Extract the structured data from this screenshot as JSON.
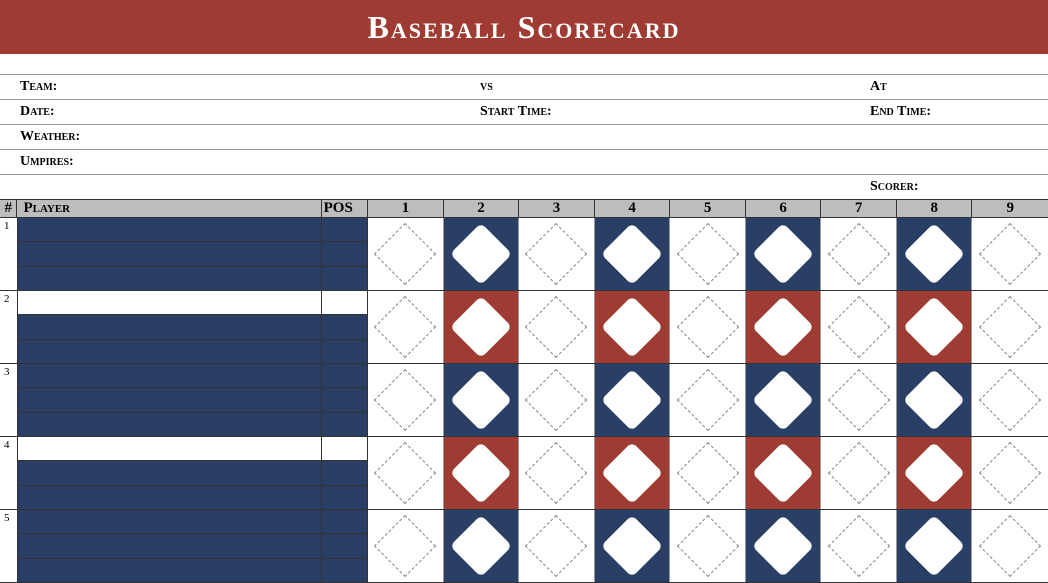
{
  "title": "Baseball Scorecard",
  "info": {
    "team_label": "Team:",
    "vs_label": "vs",
    "at_label": "At",
    "date_label": "Date:",
    "start_time_label": "Start Time:",
    "end_time_label": "End Time:",
    "weather_label": "Weather:",
    "umpires_label": "Umpires:",
    "scorer_label": "Scorer:"
  },
  "columns": {
    "num": "#",
    "player": "Player",
    "pos": "POS",
    "innings": [
      "1",
      "2",
      "3",
      "4",
      "5",
      "6",
      "7",
      "8",
      "9"
    ]
  },
  "rows": [
    {
      "num": "1",
      "odd": true,
      "pattern": [
        "w",
        "n",
        "w",
        "n",
        "w",
        "n",
        "w",
        "n",
        "w"
      ]
    },
    {
      "num": "2",
      "odd": false,
      "pattern": [
        "w",
        "r",
        "w",
        "r",
        "w",
        "r",
        "w",
        "r",
        "w"
      ]
    },
    {
      "num": "3",
      "odd": true,
      "pattern": [
        "w",
        "n",
        "w",
        "n",
        "w",
        "n",
        "w",
        "n",
        "w"
      ]
    },
    {
      "num": "4",
      "odd": false,
      "pattern": [
        "w",
        "r",
        "w",
        "r",
        "w",
        "r",
        "w",
        "r",
        "w"
      ]
    },
    {
      "num": "5",
      "odd": true,
      "pattern": [
        "w",
        "n",
        "w",
        "n",
        "w",
        "n",
        "w",
        "n",
        "w"
      ]
    }
  ]
}
